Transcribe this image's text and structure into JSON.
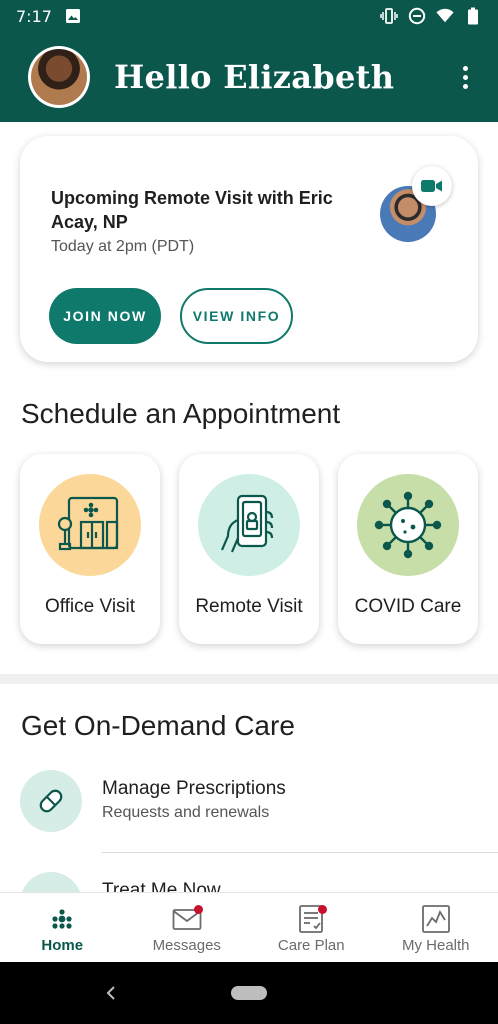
{
  "status_bar": {
    "time": "7:17",
    "icons": [
      "image-icon",
      "vibrate-icon",
      "do-not-disturb-icon",
      "wifi-icon",
      "battery-icon"
    ]
  },
  "header": {
    "greeting": "Hello Elizabeth",
    "avatar": "user-avatar",
    "menu_icon": "more-vert-icon",
    "background_color": "#0b574c"
  },
  "upcoming_visit": {
    "title": "Upcoming Remote Visit with Eric Acay, NP",
    "time": "Today at 2pm (PDT)",
    "join_label": "JOIN NOW",
    "view_label": "VIEW INFO",
    "badge_icon": "video-camera-icon",
    "accent_color": "#0f7a6c"
  },
  "schedule": {
    "title": "Schedule an Appointment",
    "tiles": [
      {
        "label": "Office Visit",
        "icon": "office-building-icon",
        "color": "#fbd79a"
      },
      {
        "label": "Remote Visit",
        "icon": "phone-hand-icon",
        "color": "#cfeee6"
      },
      {
        "label": "COVID Care",
        "icon": "virus-icon",
        "color": "#c7dea8"
      }
    ]
  },
  "on_demand": {
    "title": "Get On-Demand Care",
    "items": [
      {
        "title": "Manage Prescriptions",
        "subtitle": "Requests and renewals",
        "icon": "pill-icon"
      },
      {
        "title": "Treat Me Now",
        "icon": "treat-icon"
      }
    ]
  },
  "bottom_nav": {
    "items": [
      {
        "label": "Home",
        "icon": "home-dots-icon",
        "active": true,
        "badge": false
      },
      {
        "label": "Messages",
        "icon": "mail-icon",
        "active": false,
        "badge": true
      },
      {
        "label": "Care Plan",
        "icon": "care-plan-icon",
        "active": false,
        "badge": true
      },
      {
        "label": "My Health",
        "icon": "chart-icon",
        "active": false,
        "badge": false
      }
    ],
    "badge_color": "#c8102e"
  },
  "android_nav": {
    "back_icon": "back-chevron-icon",
    "home_icon": "home-pill-icon"
  }
}
